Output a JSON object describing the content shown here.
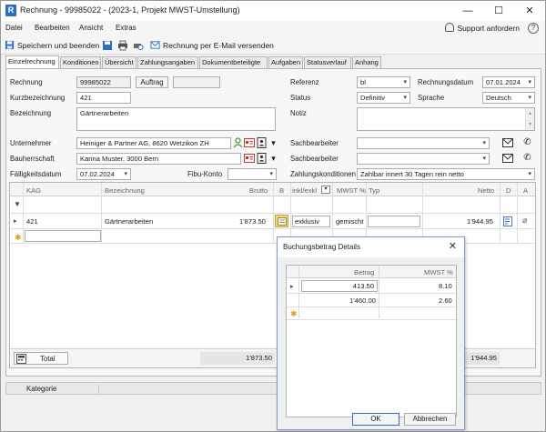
{
  "window": {
    "title": "Rechnung - 99985022 - (2023-1, Projekt MWST-Umstellung)",
    "minimize": "—",
    "maximize": "☐",
    "close": "✕"
  },
  "menu": {
    "items": [
      "Datei",
      "Bearbeiten",
      "Ansicht",
      "Extras"
    ],
    "support": "Support anfordern",
    "help": "?"
  },
  "toolbar": {
    "save_close": "Speichern und beenden",
    "email": "Rechnung per E-Mail versenden"
  },
  "tabs": [
    "Einzelrechnung",
    "Konditionen",
    "Übersicht",
    "Zahlungsangaben",
    "Dokumentbeteiligte",
    "Aufgaben",
    "Statusverlauf",
    "Anhang"
  ],
  "form": {
    "rechnung_label": "Rechnung",
    "rechnung_value": "99985022",
    "auftrag_button": "Auftrag",
    "kurz_label": "Kurzbezeichnung",
    "kurz_value": "421",
    "bez_label": "Bezeichnung",
    "bez_value": "Gärtnerarbeiten",
    "unternehmer_label": "Unternehmer",
    "unternehmer_value": "Heiniger & Partner AG, 8620 Wetzikon ZH",
    "bauherr_label": "Bauherrschaft",
    "bauherr_value": "Karina Muster, 3000 Bern",
    "faellig_label": "Fälligkeitsdatum",
    "faellig_value": "07.02.2024",
    "fibu_label": "Fibu-Konto",
    "fibu_value": "",
    "referenz_label": "Referenz",
    "referenz_value": "bl",
    "rdatum_label": "Rechnungsdatum",
    "rdatum_value": "07.01.2024",
    "status_label": "Status",
    "status_value": "Definitiv",
    "sprache_label": "Sprache",
    "sprache_value": "Deutsch",
    "notiz_label": "Notiz",
    "notiz_value": "",
    "sb1_label": "Sachbearbeiter",
    "sb1_value": "",
    "sb2_label": "Sachbearbeiter",
    "sb2_value": "",
    "zk_label": "Zahlungskonditionen",
    "zk_value": "Zahlbar innert 30 Tagen rein netto"
  },
  "grid": {
    "headers": {
      "kag": "KAG",
      "bez": "Bezeichnung",
      "brutto": "Brutto",
      "b": "B",
      "inkl": "inkl/exkl",
      "mwst": "MWST %",
      "typ": "Typ",
      "netto": "Netto",
      "d": "D",
      "a": "A"
    },
    "row": {
      "kag": "421",
      "bez": "Gärtnerarbeiten",
      "brutto": "1'873.50",
      "inkl": "exklusiv",
      "mwst": "gemischt",
      "typ": "",
      "netto": "1'944.95"
    },
    "total_label": "Total",
    "total_brutto": "1'873.50",
    "total_netto": "1'944.95"
  },
  "statusbar": {
    "kategorie": "Kategorie"
  },
  "dialog": {
    "title": "Buchungsbetrag Details",
    "headers": {
      "betrag": "Betrag",
      "mwst": "MWST %"
    },
    "rows": [
      {
        "betrag": "413.50",
        "mwst": "8.10"
      },
      {
        "betrag": "1'460.00",
        "mwst": "2.60"
      }
    ],
    "ok": "OK",
    "cancel": "Abbrechen"
  },
  "colors": {
    "accent": "#2b6cc4",
    "icon_red": "#c0392b",
    "icon_green": "#3d9a3d"
  }
}
